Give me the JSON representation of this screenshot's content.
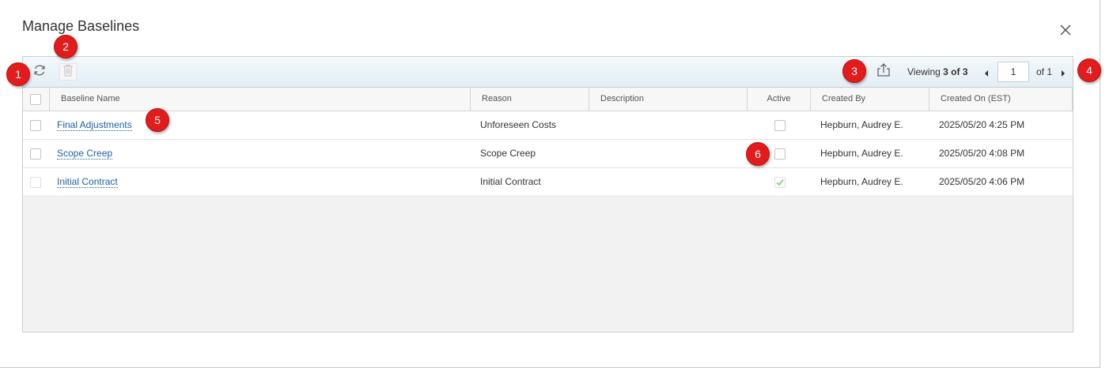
{
  "dialog": {
    "title": "Manage Baselines",
    "close_icon": "close-icon"
  },
  "toolbar": {
    "refresh_icon": "refresh-icon",
    "delete_icon": "trash-icon",
    "export_icon": "export-icon",
    "viewing_label": "Viewing",
    "viewing_count": "3 of 3",
    "page_value": "1",
    "of_pages": "of 1"
  },
  "columns": {
    "baseline_name": "Baseline Name",
    "reason": "Reason",
    "description": "Description",
    "active": "Active",
    "created_by": "Created By",
    "created_on": "Created On (EST)"
  },
  "rows": [
    {
      "name": "Final Adjustments",
      "reason": "Unforeseen Costs",
      "description": "",
      "active": false,
      "created_by": "Hepburn, Audrey E.",
      "created_on": "2025/05/20 4:25 PM"
    },
    {
      "name": "Scope Creep",
      "reason": "Scope Creep",
      "description": "",
      "active": false,
      "created_by": "Hepburn, Audrey E.",
      "created_on": "2025/05/20 4:08 PM"
    },
    {
      "name": "Initial Contract",
      "reason": "Initial Contract",
      "description": "",
      "active": true,
      "created_by": "Hepburn, Audrey E.",
      "created_on": "2025/05/20 4:06 PM"
    }
  ],
  "callouts": [
    "1",
    "2",
    "3",
    "4",
    "5",
    "6"
  ],
  "colors": {
    "link": "#1f5ea8",
    "callout": "#e21c1c",
    "check": "#7fbf7f"
  }
}
